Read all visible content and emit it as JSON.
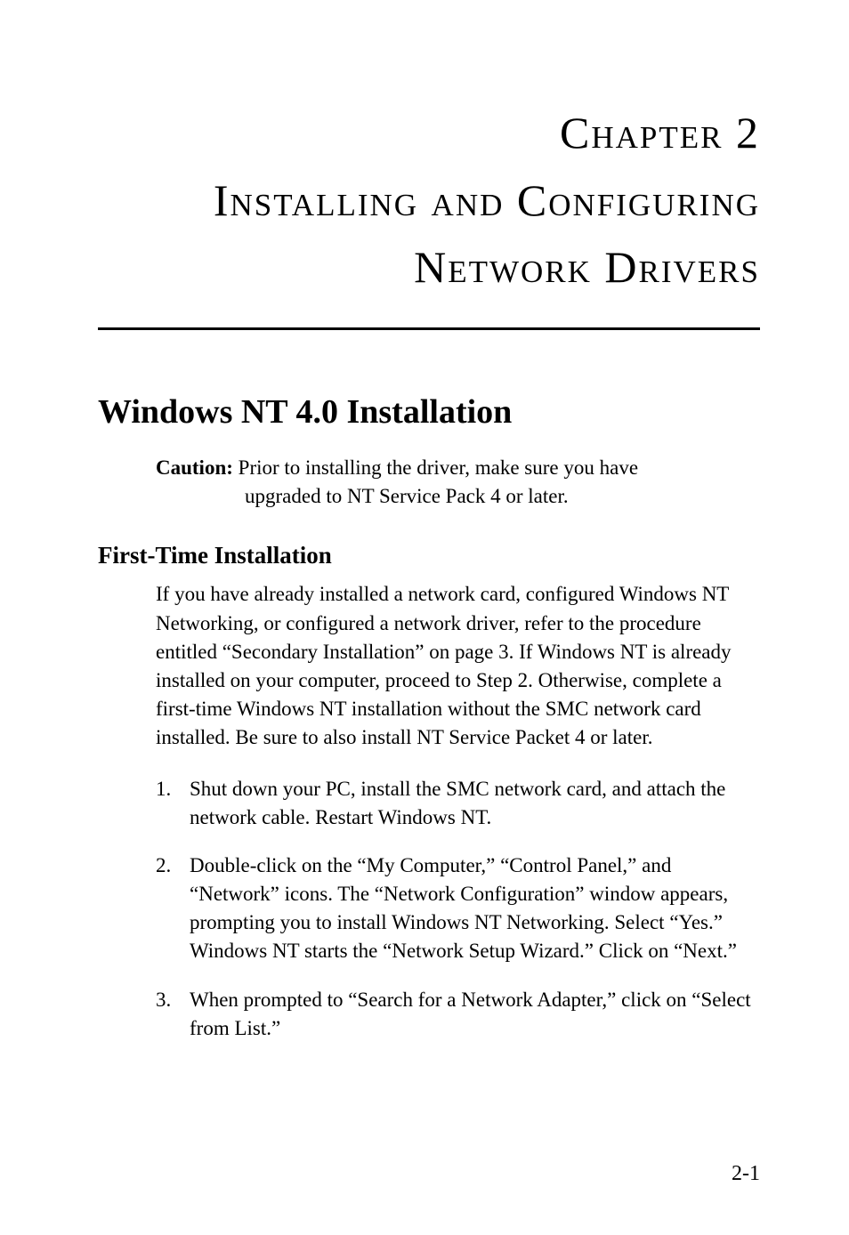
{
  "chapter": {
    "label": "Chapter 2",
    "title_line1": "Installing and Configuring",
    "title_line2": "Network Drivers"
  },
  "section": {
    "heading": "Windows NT 4.0 Installation",
    "caution": {
      "label": "Caution:",
      "text_line1": "Prior to installing the driver, make sure you have",
      "text_line2": "upgraded to NT Service Pack 4 or later."
    },
    "subsection": {
      "heading": "First-Time Installation",
      "paragraph": "If you have already installed a network card, configured Windows NT Networking, or configured a network driver, refer to the procedure entitled “Secondary Installation” on page 3. If Windows NT is already installed on your computer, proceed to Step 2. Otherwise, complete a first-time Windows NT installation without the SMC network card installed. Be sure to also install NT Service Packet 4 or later.",
      "steps": [
        {
          "num": "1.",
          "text": "Shut down your PC, install the SMC network card, and attach the network cable. Restart Windows NT."
        },
        {
          "num": "2.",
          "text": "Double-click on the “My Computer,” “Control Panel,” and “Network” icons. The “Network Configuration” window appears, prompting you to install Windows NT Networking. Select “Yes.” Windows NT starts the “Network Setup Wizard.” Click on “Next.”"
        },
        {
          "num": "3.",
          "text": "When prompted to “Search for a Network Adapter,” click on “Select from List.”"
        }
      ]
    }
  },
  "page_number": "2-1"
}
